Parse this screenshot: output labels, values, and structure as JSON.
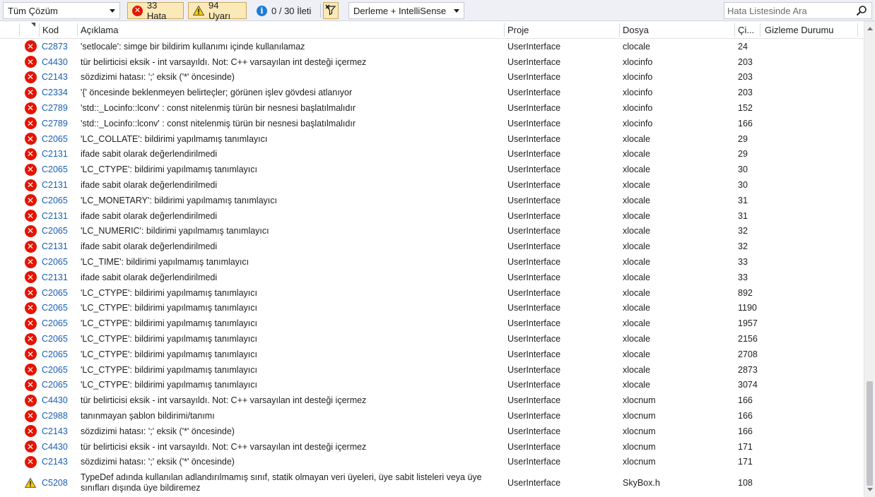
{
  "toolbar": {
    "scope": "Tüm Çözüm",
    "errors_label": "33 Hata",
    "warnings_label": "94 Uyarı",
    "messages_label": "0 / 30 İleti",
    "build_filter": "Derleme + IntelliSense",
    "search_placeholder": "Hata Listesinde Ara"
  },
  "columns": {
    "code": "Kod",
    "description": "Açıklama",
    "project": "Proje",
    "file": "Dosya",
    "line": "Çi...",
    "suppression": "Gizleme Durumu"
  },
  "rows": [
    {
      "severity": "error",
      "code": "C2873",
      "description": "'setlocale': simge bir bildirim kullanımı içinde kullanılamaz",
      "project": "UserInterface",
      "file": "clocale",
      "line": "24"
    },
    {
      "severity": "error",
      "code": "C4430",
      "description": "tür belirticisi eksik - int varsayıldı. Not: C++ varsayılan int desteği içermez",
      "project": "UserInterface",
      "file": "xlocinfo",
      "line": "203"
    },
    {
      "severity": "error",
      "code": "C2143",
      "description": "sözdizimi hatası: ';' eksik ('*' öncesinde)",
      "project": "UserInterface",
      "file": "xlocinfo",
      "line": "203"
    },
    {
      "severity": "error",
      "code": "C2334",
      "description": "'{' öncesinde beklenmeyen belirteçler; görünen işlev gövdesi atlanıyor",
      "project": "UserInterface",
      "file": "xlocinfo",
      "line": "203"
    },
    {
      "severity": "error",
      "code": "C2789",
      "description": "'std::_Locinfo::lconv' : const nitelenmiş türün bir nesnesi başlatılmalıdır",
      "project": "UserInterface",
      "file": "xlocinfo",
      "line": "152"
    },
    {
      "severity": "error",
      "code": "C2789",
      "description": "'std::_Locinfo::lconv' : const nitelenmiş türün bir nesnesi başlatılmalıdır",
      "project": "UserInterface",
      "file": "xlocinfo",
      "line": "166"
    },
    {
      "severity": "error",
      "code": "C2065",
      "description": "'LC_COLLATE': bildirimi yapılmamış tanımlayıcı",
      "project": "UserInterface",
      "file": "xlocale",
      "line": "29"
    },
    {
      "severity": "error",
      "code": "C2131",
      "description": "ifade sabit olarak değerlendirilmedi",
      "project": "UserInterface",
      "file": "xlocale",
      "line": "29"
    },
    {
      "severity": "error",
      "code": "C2065",
      "description": "'LC_CTYPE': bildirimi yapılmamış tanımlayıcı",
      "project": "UserInterface",
      "file": "xlocale",
      "line": "30"
    },
    {
      "severity": "error",
      "code": "C2131",
      "description": "ifade sabit olarak değerlendirilmedi",
      "project": "UserInterface",
      "file": "xlocale",
      "line": "30"
    },
    {
      "severity": "error",
      "code": "C2065",
      "description": "'LC_MONETARY': bildirimi yapılmamış tanımlayıcı",
      "project": "UserInterface",
      "file": "xlocale",
      "line": "31"
    },
    {
      "severity": "error",
      "code": "C2131",
      "description": "ifade sabit olarak değerlendirilmedi",
      "project": "UserInterface",
      "file": "xlocale",
      "line": "31"
    },
    {
      "severity": "error",
      "code": "C2065",
      "description": "'LC_NUMERIC': bildirimi yapılmamış tanımlayıcı",
      "project": "UserInterface",
      "file": "xlocale",
      "line": "32"
    },
    {
      "severity": "error",
      "code": "C2131",
      "description": "ifade sabit olarak değerlendirilmedi",
      "project": "UserInterface",
      "file": "xlocale",
      "line": "32"
    },
    {
      "severity": "error",
      "code": "C2065",
      "description": "'LC_TIME': bildirimi yapılmamış tanımlayıcı",
      "project": "UserInterface",
      "file": "xlocale",
      "line": "33"
    },
    {
      "severity": "error",
      "code": "C2131",
      "description": "ifade sabit olarak değerlendirilmedi",
      "project": "UserInterface",
      "file": "xlocale",
      "line": "33"
    },
    {
      "severity": "error",
      "code": "C2065",
      "description": "'LC_CTYPE': bildirimi yapılmamış tanımlayıcı",
      "project": "UserInterface",
      "file": "xlocale",
      "line": "892"
    },
    {
      "severity": "error",
      "code": "C2065",
      "description": "'LC_CTYPE': bildirimi yapılmamış tanımlayıcı",
      "project": "UserInterface",
      "file": "xlocale",
      "line": "1190"
    },
    {
      "severity": "error",
      "code": "C2065",
      "description": "'LC_CTYPE': bildirimi yapılmamış tanımlayıcı",
      "project": "UserInterface",
      "file": "xlocale",
      "line": "1957"
    },
    {
      "severity": "error",
      "code": "C2065",
      "description": "'LC_CTYPE': bildirimi yapılmamış tanımlayıcı",
      "project": "UserInterface",
      "file": "xlocale",
      "line": "2156"
    },
    {
      "severity": "error",
      "code": "C2065",
      "description": "'LC_CTYPE': bildirimi yapılmamış tanımlayıcı",
      "project": "UserInterface",
      "file": "xlocale",
      "line": "2708"
    },
    {
      "severity": "error",
      "code": "C2065",
      "description": "'LC_CTYPE': bildirimi yapılmamış tanımlayıcı",
      "project": "UserInterface",
      "file": "xlocale",
      "line": "2873"
    },
    {
      "severity": "error",
      "code": "C2065",
      "description": "'LC_CTYPE': bildirimi yapılmamış tanımlayıcı",
      "project": "UserInterface",
      "file": "xlocale",
      "line": "3074"
    },
    {
      "severity": "error",
      "code": "C4430",
      "description": "tür belirticisi eksik - int varsayıldı. Not: C++ varsayılan int desteği içermez",
      "project": "UserInterface",
      "file": "xlocnum",
      "line": "166"
    },
    {
      "severity": "error",
      "code": "C2988",
      "description": "tanınmayan şablon bildirimi/tanımı",
      "project": "UserInterface",
      "file": "xlocnum",
      "line": "166"
    },
    {
      "severity": "error",
      "code": "C2143",
      "description": "sözdizimi hatası: ';' eksik ('*' öncesinde)",
      "project": "UserInterface",
      "file": "xlocnum",
      "line": "166"
    },
    {
      "severity": "error",
      "code": "C4430",
      "description": "tür belirticisi eksik - int varsayıldı. Not: C++ varsayılan int desteği içermez",
      "project": "UserInterface",
      "file": "xlocnum",
      "line": "171"
    },
    {
      "severity": "error",
      "code": "C2143",
      "description": "sözdizimi hatası: ';' eksik ('*' öncesinde)",
      "project": "UserInterface",
      "file": "xlocnum",
      "line": "171"
    },
    {
      "severity": "warning",
      "code": "C5208",
      "description": "TypeDef adında kullanılan adlandırılmamış sınıf, statik olmayan veri üyeleri, üye sabit listeleri veya üye sınıfları dışında üye bildiremez",
      "project": "UserInterface",
      "file": "SkyBox.h",
      "line": "108"
    }
  ],
  "colors": {
    "error": "#e51400",
    "warning": "#f2c811",
    "info": "#1e7cd4",
    "code_link": "#1a5fb4",
    "active_filter_bg": "#fbe9b7"
  },
  "icons": {
    "error": "error-circle-icon",
    "warning": "warning-triangle-icon",
    "info": "info-icon",
    "search": "search-icon",
    "clear_filter": "clear-filter-icon"
  }
}
